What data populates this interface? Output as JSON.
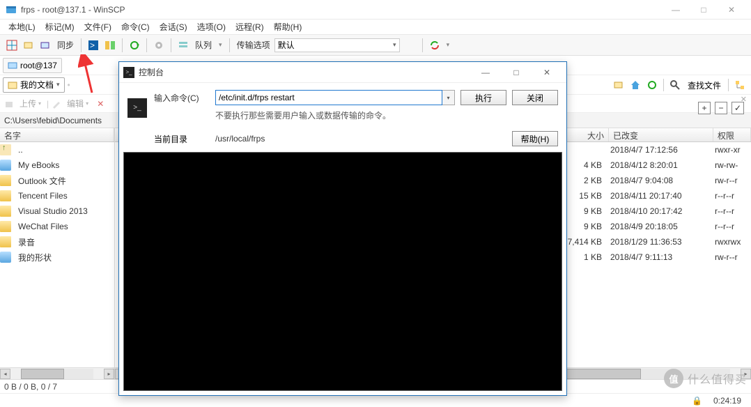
{
  "window": {
    "title": "frps - root@137.1            - WinSCP",
    "min": "—",
    "max": "□",
    "close": "✕"
  },
  "menu": [
    "本地(L)",
    "标记(M)",
    "文件(F)",
    "命令(C)",
    "会话(S)",
    "选项(O)",
    "远程(R)",
    "帮助(H)"
  ],
  "toolbar": {
    "sync": "同步",
    "queue": "队列",
    "transfer_label": "传输选项",
    "transfer_value": "默认"
  },
  "path_left": {
    "combo": "root@137",
    "docs": "我的文档"
  },
  "actions": {
    "upload": "上传",
    "edit": "编辑"
  },
  "breadcrumb": "C:\\Users\\febid\\Documents",
  "columns": {
    "name": "名字",
    "size": "大小",
    "changed": "已改变",
    "perm": "权限"
  },
  "left_items": [
    {
      "icon": "up",
      "label": ".."
    },
    {
      "icon": "blue",
      "label": "My eBooks"
    },
    {
      "icon": "folder",
      "label": "Outlook 文件"
    },
    {
      "icon": "folder",
      "label": "Tencent Files"
    },
    {
      "icon": "folder",
      "label": "Visual Studio 2013"
    },
    {
      "icon": "folder",
      "label": "WeChat Files"
    },
    {
      "icon": "folder",
      "label": "录音"
    },
    {
      "icon": "blue",
      "label": "我的形状"
    }
  ],
  "right_rows": [
    {
      "size": "",
      "date": "2018/4/7 17:12:56",
      "perm": "rwxr-xr"
    },
    {
      "size": "4 KB",
      "date": "2018/4/12 8:20:01",
      "perm": "rw-rw-"
    },
    {
      "size": "2 KB",
      "date": "2018/4/7 9:04:08",
      "perm": "rw-r--r"
    },
    {
      "size": "15 KB",
      "date": "2018/4/11 20:17:40",
      "perm": "r--r--r"
    },
    {
      "size": "9 KB",
      "date": "2018/4/10 20:17:42",
      "perm": "r--r--r"
    },
    {
      "size": "9 KB",
      "date": "2018/4/9 20:18:05",
      "perm": "r--r--r"
    },
    {
      "size": "7,414 KB",
      "date": "2018/1/29 11:36:53",
      "perm": "rwxrwx"
    },
    {
      "size": "1 KB",
      "date": "2018/4/7 9:11:13",
      "perm": "rw-r--r"
    }
  ],
  "status": {
    "sel": "0 B / 0 B,   0 / 7",
    "elapsed": "0:24:19"
  },
  "rtool": {
    "find": "查找文件"
  },
  "dialog": {
    "title": "控制台",
    "cmd_label": "输入命令(C)",
    "cmd_value": "/etc/init.d/frps restart",
    "exec": "执行",
    "close": "关闭",
    "hint": "不要执行那些需要用户输入或数据传输的命令。",
    "cwd_label": "当前目录",
    "cwd_value": "/usr/local/frps",
    "help": "帮助(H)",
    "min": "—",
    "max": "□",
    "x": "✕"
  },
  "watermark": "什么值得买"
}
